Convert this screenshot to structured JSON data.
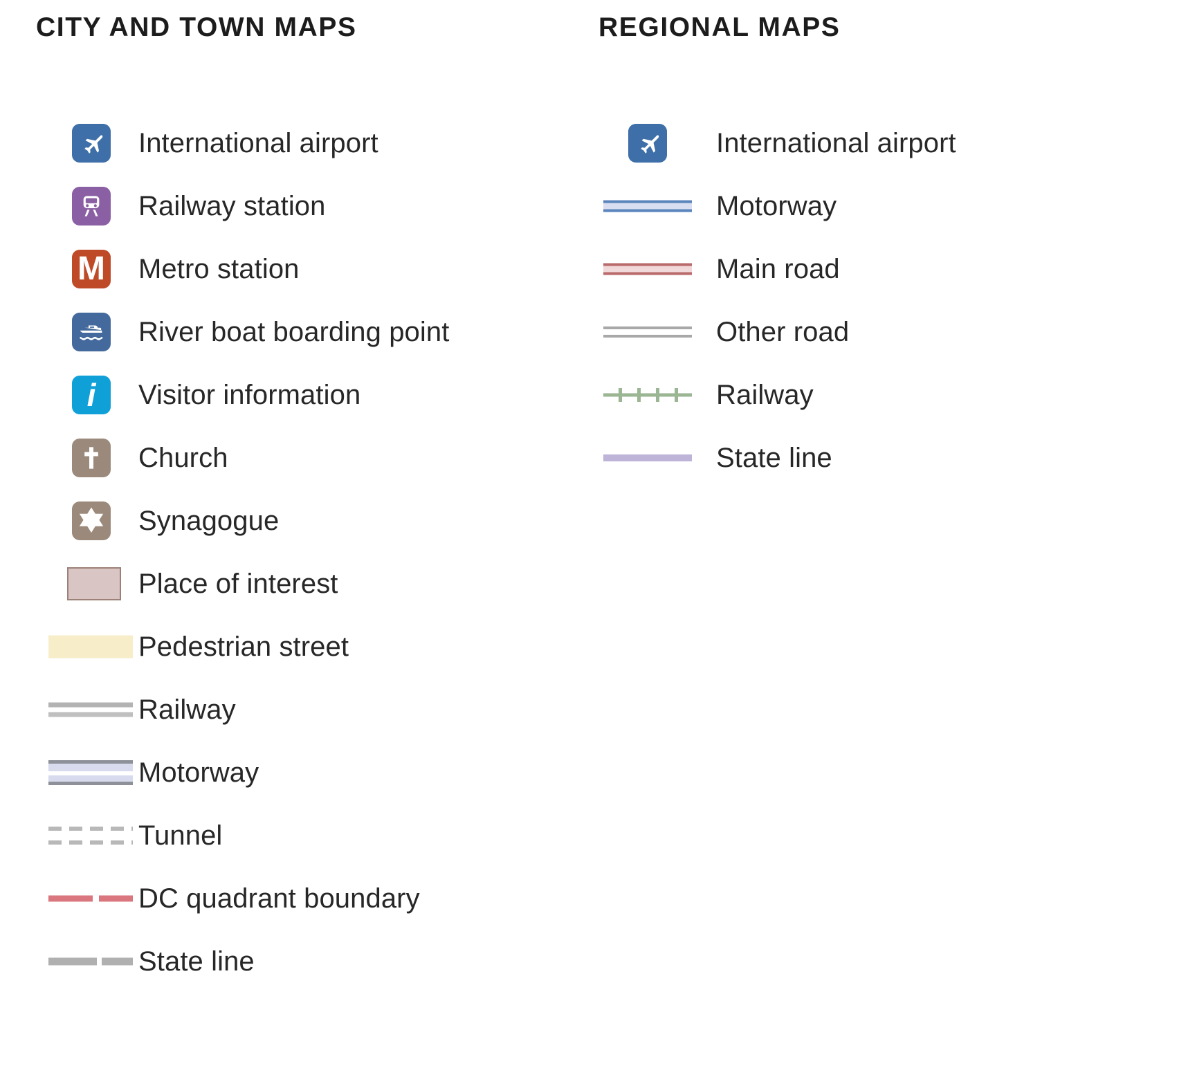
{
  "columns": [
    {
      "key": "city",
      "heading": "CITY AND TOWN MAPS",
      "items": [
        {
          "label": "International airport",
          "symbol": "airport-icon",
          "color": "#3e6fa8"
        },
        {
          "label": "Railway station",
          "symbol": "railway-station-icon",
          "color": "#8a5fa3"
        },
        {
          "label": "Metro station",
          "symbol": "metro-icon",
          "color": "#bf4a28"
        },
        {
          "label": "River boat boarding point",
          "symbol": "river-boat-icon",
          "color": "#44699c"
        },
        {
          "label": "Visitor information",
          "symbol": "information-icon",
          "color": "#10a0d8"
        },
        {
          "label": "Church",
          "symbol": "church-icon",
          "color": "#9b8a7c"
        },
        {
          "label": "Synagogue",
          "symbol": "synagogue-icon",
          "color": "#9b8a7c"
        },
        {
          "label": "Place of interest",
          "symbol": "place-of-interest-swatch",
          "color": "#d9c6c4"
        },
        {
          "label": "Pedestrian street",
          "symbol": "pedestrian-street-swatch",
          "color": "#f8edc9"
        },
        {
          "label": "Railway",
          "symbol": "railway-line-swatch",
          "color": "#b8b8b8"
        },
        {
          "label": "Motorway",
          "symbol": "motorway-line-swatch",
          "color": "#d7dbed"
        },
        {
          "label": "Tunnel",
          "symbol": "tunnel-line-swatch",
          "color": "#b8b8b8"
        },
        {
          "label": "DC quadrant boundary",
          "symbol": "dc-quadrant-line-swatch",
          "color": "#d9767e"
        },
        {
          "label": "State line",
          "symbol": "state-line-swatch",
          "color": "#b0b0b0"
        }
      ]
    },
    {
      "key": "regional",
      "heading": "REGIONAL MAPS",
      "items": [
        {
          "label": "International airport",
          "symbol": "airport-icon",
          "color": "#3e6fa8"
        },
        {
          "label": "Motorway",
          "symbol": "regional-motorway-swatch",
          "color": "#5b84bd"
        },
        {
          "label": "Main road",
          "symbol": "regional-main-road-swatch",
          "color": "#b96a6a"
        },
        {
          "label": "Other road",
          "symbol": "regional-other-road-swatch",
          "color": "#a8a8a8"
        },
        {
          "label": "Railway",
          "symbol": "regional-railway-swatch",
          "color": "#9bb693"
        },
        {
          "label": "State line",
          "symbol": "regional-state-line-swatch",
          "color": "#bdb4d8"
        }
      ]
    }
  ],
  "glyphs": {
    "metro": "M",
    "information": "i"
  }
}
